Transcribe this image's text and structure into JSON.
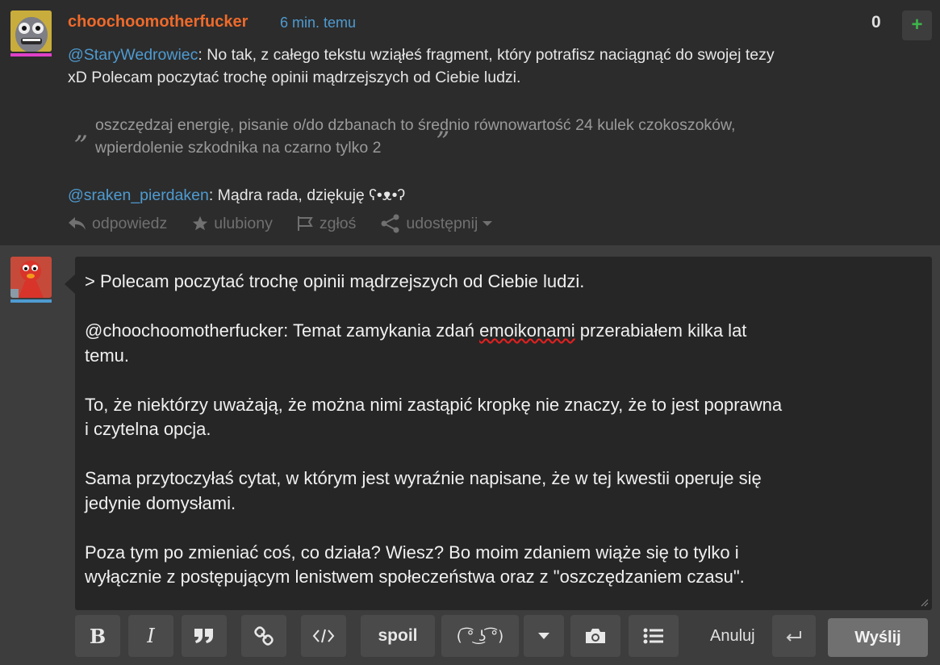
{
  "comment": {
    "author": "choochoomotherfucker",
    "time": "6 min. temu",
    "votes": "0",
    "plus_label": "+",
    "para1_mention": "@StaryWedrowiec",
    "para1_line1": ": No tak, z całego tekstu wziąłeś fragment, który potrafisz naciągnąć do swojej tezy",
    "para1_line2": "xD Polecam poczytać trochę opinii mądrzejszych od Ciebie ludzi.",
    "quote_line1": "oszczędzaj energię, pisanie o/do dzbanach to średnio równowartość 24 kulek czokoszoków,",
    "quote_line2": "wpierdolenie szkodnika na czarno tylko 2",
    "quote_open": "„",
    "quote_close": "”",
    "para2_mention": "@sraken_pierdaken",
    "para2_text": ": Mądra rada, dziękuję ʕ•ᴥ•ʔ",
    "actions": {
      "reply": "odpowiedz",
      "favorite": "ulubiony",
      "report": "zgłoś",
      "share": "udostępnij"
    }
  },
  "reply_box": {
    "line1": "> Polecam poczytać trochę opinii mądrzejszych od Ciebie ludzi.",
    "line2a": "@choochoomotherfucker: Temat zamykania zdań ",
    "line2_misspelled": "emoikonami",
    "line2b": " przerabiałem kilka lat",
    "line3": "temu.",
    "line4": "To, że niektórzy uważają, że można nimi zastąpić kropkę nie znaczy, że to jest poprawna",
    "line5": "i czytelna opcja.",
    "line6": "Sama przytoczyłaś cytat, w którym jest wyraźnie napisane, że w tej kwestii operuje się",
    "line7": "jedynie domysłami.",
    "line8": "Poza tym po zmieniać coś, co działa? Wiesz? Bo moim zdaniem wiąże się to tylko i",
    "line9": "wyłącznie z postępującym lenistwem społeczeństwa oraz z \"oszczędzaniem czasu\"."
  },
  "toolbar": {
    "bold": "B",
    "italic": "I",
    "spoil": "spoil",
    "lenny": "( ͡° ͜ʖ ͡°)",
    "cancel": "Anuluj",
    "send": "Wyślij"
  },
  "colors": {
    "author": "#ef6a2a",
    "link": "#4e9bd1",
    "plus": "#3db54a",
    "background": "#2c2c2c",
    "editor": "#262626"
  }
}
